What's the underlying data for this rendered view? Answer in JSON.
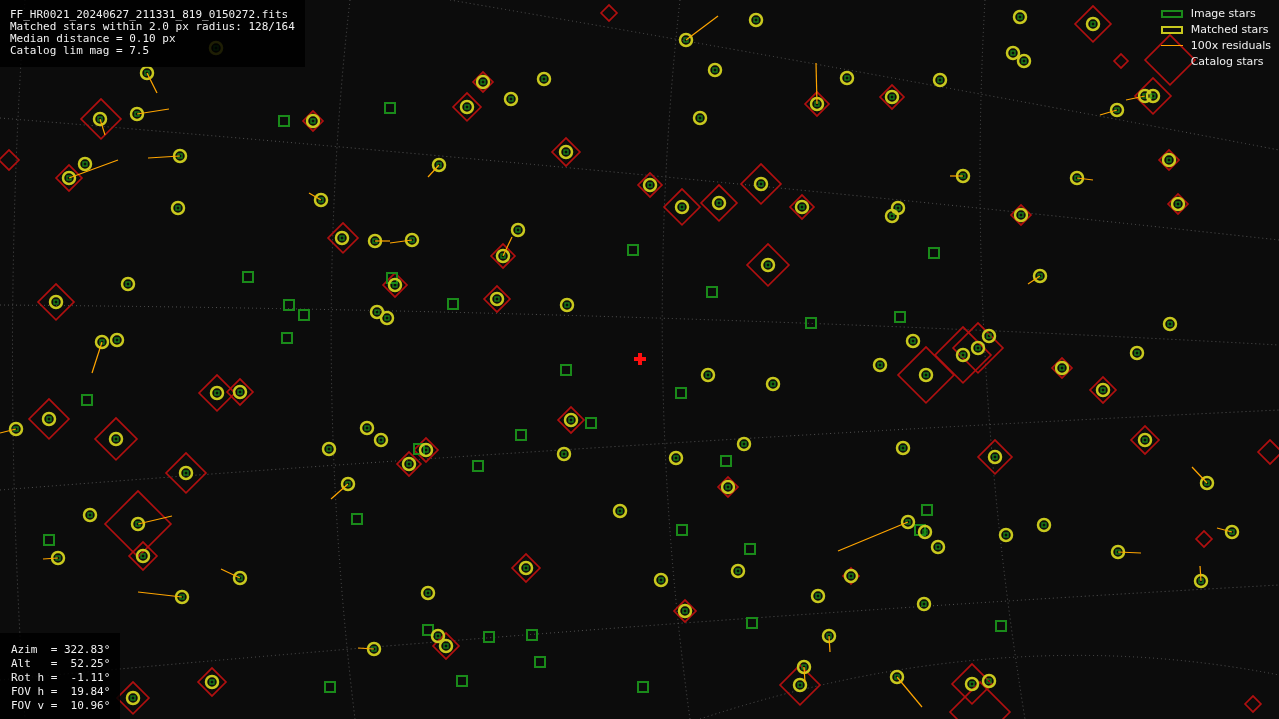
{
  "info_top": [
    "FF_HR0021_20240627_211331_819_0150272.fits",
    "Matched stars within 2.0 px radius: 128/164",
    "Median distance = 0.10 px",
    "Catalog lim mag = 7.5"
  ],
  "legend": [
    {
      "kind": "box",
      "label": "Image stars",
      "color": "#1a8a1a"
    },
    {
      "kind": "box",
      "label": "Matched stars",
      "color": "#c8c81e"
    },
    {
      "kind": "line",
      "label": "100x residuals",
      "color": "#ffa500"
    },
    {
      "kind": "none",
      "label": "Catalog stars"
    }
  ],
  "info_bottom": [
    "Azim  = 322.83°",
    "Alt   =  52.25°",
    "Rot h =  -1.11°",
    "FOV h =  19.84°",
    "FOV v =  10.96°"
  ]
}
